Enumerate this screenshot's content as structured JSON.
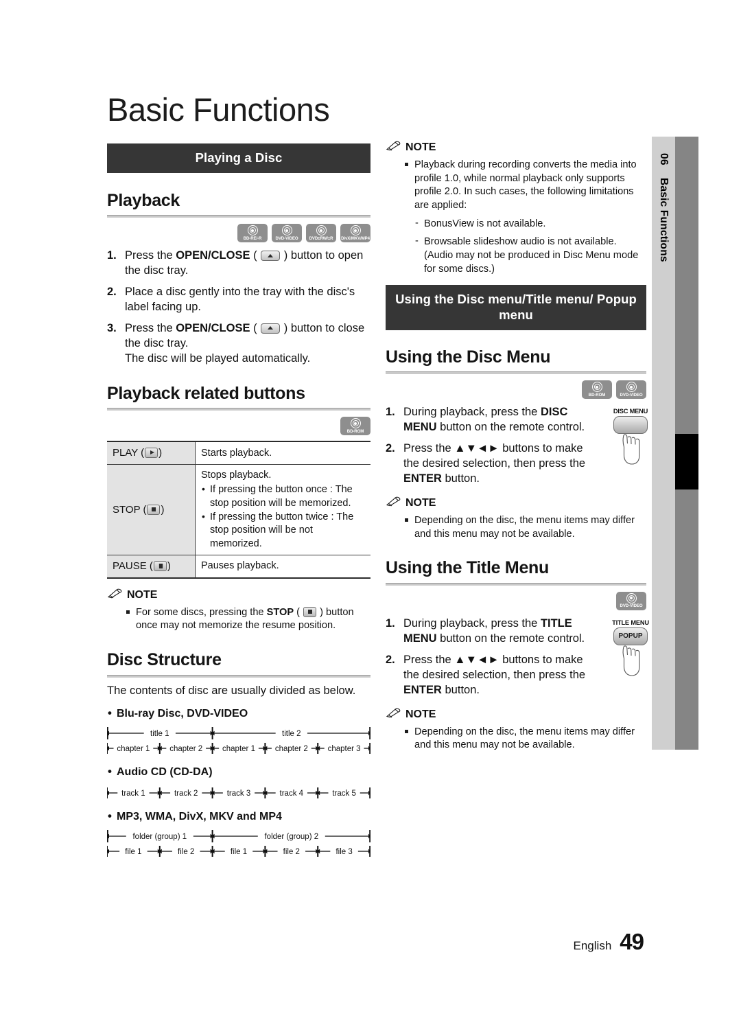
{
  "document": {
    "title": "Basic Functions",
    "language": "English",
    "page_number": "49",
    "side_tab": {
      "chapter_number": "06",
      "chapter_label": "Basic Functions"
    }
  },
  "left": {
    "band_title": "Playing a Disc",
    "playback": {
      "heading": "Playback",
      "badges": [
        {
          "label": "BD-RE/-R",
          "icon": "disc-icon"
        },
        {
          "label": "DVD-VIDEO",
          "icon": "disc-icon"
        },
        {
          "label": "DVD±RW/±R",
          "icon": "disc-icon"
        },
        {
          "label": "DivX/MKV/MP4",
          "icon": "film-disc-icon"
        }
      ],
      "steps": [
        {
          "n": "1.",
          "html": "Press the <b>OPEN/CLOSE</b> ( <span class=\"keycap\" data-name=\"open-close-key-icon\" data-interactable=\"false\"></span> ) button to open the disc tray."
        },
        {
          "n": "2.",
          "html": "Place a disc gently into the tray with the disc's label facing up."
        },
        {
          "n": "3.",
          "html": "Press the <b>OPEN/CLOSE</b> ( <span class=\"keycap\" data-name=\"open-close-key-icon\" data-interactable=\"false\"></span> ) button to close the disc tray.<br>The disc will be played automatically."
        }
      ]
    },
    "related_buttons": {
      "heading": "Playback related buttons",
      "badges": [
        {
          "label": "BD-ROM",
          "icon": "disc-icon"
        }
      ],
      "rows": [
        {
          "key_html": "PLAY (<span class=\"kb play\" data-name=\"play-key-icon\" data-interactable=\"false\"></span>)",
          "value_html": "Starts playback."
        },
        {
          "key_html": "STOP (<span class=\"kb stop\" data-name=\"stop-key-icon\" data-interactable=\"false\"></span>)",
          "value_html": "Stops playback.<ul class=\"bul\"><li>If pressing the button once : The stop position will be memorized.</li><li>If pressing the button twice : The stop position will be not memorized.</li></ul>"
        },
        {
          "key_html": "PAUSE (<span class=\"kb pause\" data-name=\"pause-key-icon\" data-interactable=\"false\"></span>)",
          "value_html": "Pauses playback."
        }
      ]
    },
    "note": {
      "label": "NOTE",
      "items_html": [
        "For some discs, pressing the <b>STOP</b> ( <span class=\"kb stop\" data-name=\"stop-key-icon\" data-interactable=\"false\"></span> ) button once may not memorize the resume position."
      ]
    },
    "disc_structure": {
      "heading": "Disc Structure",
      "intro": "The contents of disc are usually divided as below.",
      "groups": [
        {
          "label": "Blu-ray Disc, DVD-VIDEO",
          "top_row": [
            "title 1",
            "title 2"
          ],
          "top_spans": [
            2,
            3
          ],
          "bottom_row": [
            "chapter 1",
            "chapter 2",
            "chapter 1",
            "chapter 2",
            "chapter 3"
          ]
        },
        {
          "label": "Audio CD (CD-DA)",
          "top_row": [],
          "top_spans": [],
          "bottom_row": [
            "track 1",
            "track 2",
            "track 3",
            "track 4",
            "track 5"
          ]
        },
        {
          "label": "MP3, WMA, DivX, MKV and MP4",
          "top_row": [
            "folder (group) 1",
            "folder (group) 2"
          ],
          "top_spans": [
            2,
            3
          ],
          "bottom_row": [
            "file 1",
            "file 2",
            "file 1",
            "file 2",
            "file 3"
          ]
        }
      ]
    }
  },
  "right": {
    "note_top": {
      "label": "NOTE",
      "items_html": [
        "Playback during recording converts the media into profile 1.0, while normal playback only supports profile 2.0. In such cases, the following limitations are applied:"
      ],
      "dashes": [
        "BonusView is not available.",
        "Browsable slideshow audio is not available. (Audio may not be produced in Disc Menu mode for some discs.)"
      ]
    },
    "band_title": "Using the Disc menu/Title menu/ Popup menu",
    "disc_menu": {
      "heading": "Using the Disc Menu",
      "badges": [
        {
          "label": "BD-ROM",
          "icon": "disc-icon"
        },
        {
          "label": "DVD-VIDEO",
          "icon": "disc-icon"
        }
      ],
      "remote": {
        "caption": "DISC MENU",
        "button_label": ""
      },
      "steps": [
        {
          "n": "1.",
          "html": "During playback, press the <b>DISC MENU</b> button on the remote control."
        },
        {
          "n": "2.",
          "html": "Press the ▲▼◄► buttons to make the desired selection, then press the <b>ENTER</b> button."
        }
      ],
      "note": {
        "label": "NOTE",
        "items_html": [
          "Depending on the disc, the menu items may differ and this menu may not be available."
        ]
      }
    },
    "title_menu": {
      "heading": "Using the Title Menu",
      "badges": [
        {
          "label": "DVD-VIDEO",
          "icon": "disc-icon"
        }
      ],
      "remote": {
        "caption": "TITLE MENU",
        "button_label": "POPUP"
      },
      "steps": [
        {
          "n": "1.",
          "html": "During playback, press the <b>TITLE MENU</b> button on the remote control."
        },
        {
          "n": "2.",
          "html": "Press the ▲▼◄► buttons to make the desired selection, then press the <b>ENTER</b> button."
        }
      ],
      "note": {
        "label": "NOTE",
        "items_html": [
          "Depending on the disc, the menu items may differ and this menu may not be available."
        ]
      }
    }
  },
  "colors": {
    "band_bg": "#363636",
    "table_key_bg": "#e3e3e3",
    "badge_bg": "#8e8e8e",
    "sidetab_light": "#cfcfcf",
    "sidetab_dark": "#858585"
  }
}
